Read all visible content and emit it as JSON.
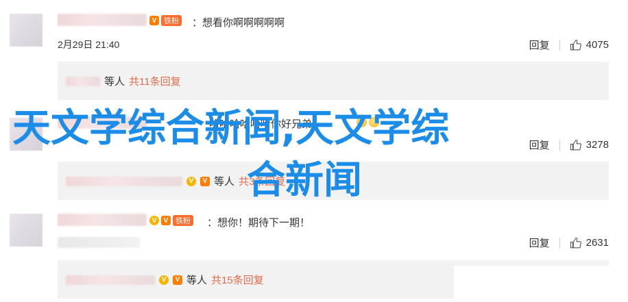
{
  "comments": [
    {
      "text": "：想看你啊啊啊啊啊",
      "time": "2月29日 21:40",
      "reply_label": "回复",
      "likes": "4075",
      "fan_badge": "铁粉",
      "sub": {
        "label": "等人",
        "count": "共11条回复"
      }
    },
    {
      "text": "哈哈哈哈哈哈你好兄弟",
      "reply_label": "回复",
      "likes": "3278",
      "sub": {
        "label": "等人",
        "count": "共3条回复"
      }
    },
    {
      "text": "：想你！期待下一期！",
      "reply_label": "回复",
      "likes": "2631",
      "fan_badge": "铁粉",
      "sub": {
        "label": "等人",
        "count": "共15条回复"
      }
    }
  ],
  "overlay": {
    "line1": "天文学综合新闻,天文学综",
    "line2": "合新闻",
    "color": "#1b8ce8"
  },
  "icons": {
    "like": "thumbs-up-icon",
    "verified": "v-badge-icon"
  }
}
